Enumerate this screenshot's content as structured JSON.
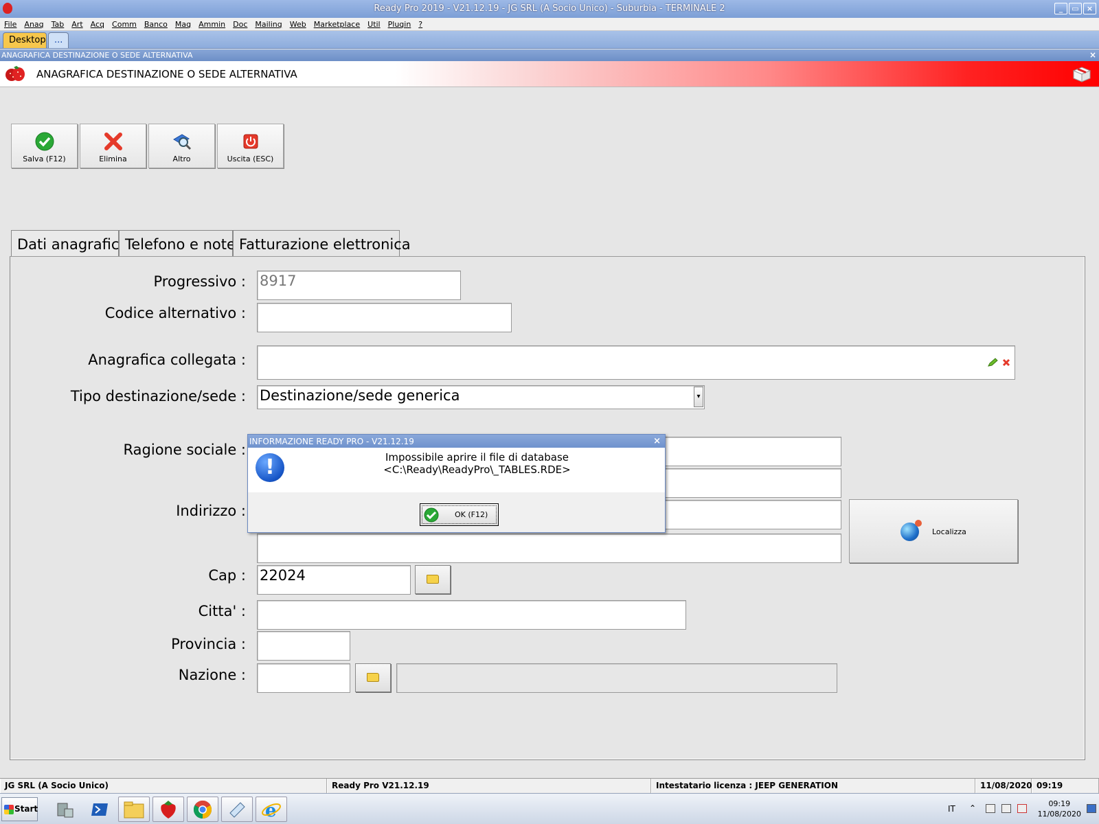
{
  "window": {
    "title": "Ready Pro 2019 - V21.12.19 - JG SRL (A Socio Unico) - Suburbia - TERMINALE 2",
    "controls": {
      "minimize": "_",
      "restore": "▭",
      "close": "×"
    }
  },
  "menu": [
    "File",
    "Anag",
    "Tab",
    "Art",
    "Acq",
    "Comm",
    "Banco",
    "Mag",
    "Ammin",
    "Doc",
    "Mailing",
    "Web",
    "Marketplace",
    "Util",
    "Plugin",
    "?"
  ],
  "desktop_tabs": {
    "desktop": "Desktop",
    "more": "..."
  },
  "form": {
    "caption": "ANAGRAFICA DESTINAZIONE O SEDE ALTERNATIVA",
    "close": "×",
    "heading": "ANAGRAFICA DESTINAZIONE O SEDE ALTERNATIVA"
  },
  "toolbar": {
    "save": "Salva (F12)",
    "delete": "Elimina",
    "other": "Altro",
    "exit": "Uscita (ESC)"
  },
  "tabs": [
    "Dati anagrafici",
    "Telefono e note",
    "Fatturazione elettronica"
  ],
  "fields": {
    "progressivo": {
      "label": "Progressivo :",
      "value": "8917"
    },
    "codice_alternativo": {
      "label": "Codice alternativo :",
      "value": ""
    },
    "anagrafica_collegata": {
      "label": "Anagrafica collegata :",
      "value": ""
    },
    "tipo_destinazione": {
      "label": "Tipo destinazione/sede :",
      "value": "Destinazione/sede generica"
    },
    "ragione_sociale": {
      "label": "Ragione sociale :",
      "value": ""
    },
    "indirizzo": {
      "label": "Indirizzo :",
      "value": ""
    },
    "cap": {
      "label": "Cap :",
      "value": "22024"
    },
    "citta": {
      "label": "Citta' :",
      "value": ""
    },
    "provincia": {
      "label": "Provincia :",
      "value": ""
    },
    "nazione": {
      "label": "Nazione :",
      "value": ""
    }
  },
  "locate_button": "Localizza",
  "dialog": {
    "title": "INFORMAZIONE READY PRO - V21.12.19",
    "close": "×",
    "message_line1": "Impossibile aprire il file di database",
    "message_line2": "<C:\\Ready\\ReadyPro\\_TABLES.RDE>",
    "ok": "OK (F12)"
  },
  "statusbar": {
    "company": "JG SRL (A Socio Unico)",
    "version": "Ready Pro V21.12.19",
    "license": "Intestatario licenza : JEEP GENERATION",
    "date": "11/08/2020",
    "time": "09:19"
  },
  "taskbar": {
    "start": "Start",
    "lang": "IT",
    "clock_time": "09:19",
    "clock_date": "11/08/2020"
  },
  "colors": {
    "titlebar": "#7c9fd6",
    "header_red": "#ff0000",
    "accent_green": "#2aa836",
    "delete_red": "#e53a2a"
  }
}
